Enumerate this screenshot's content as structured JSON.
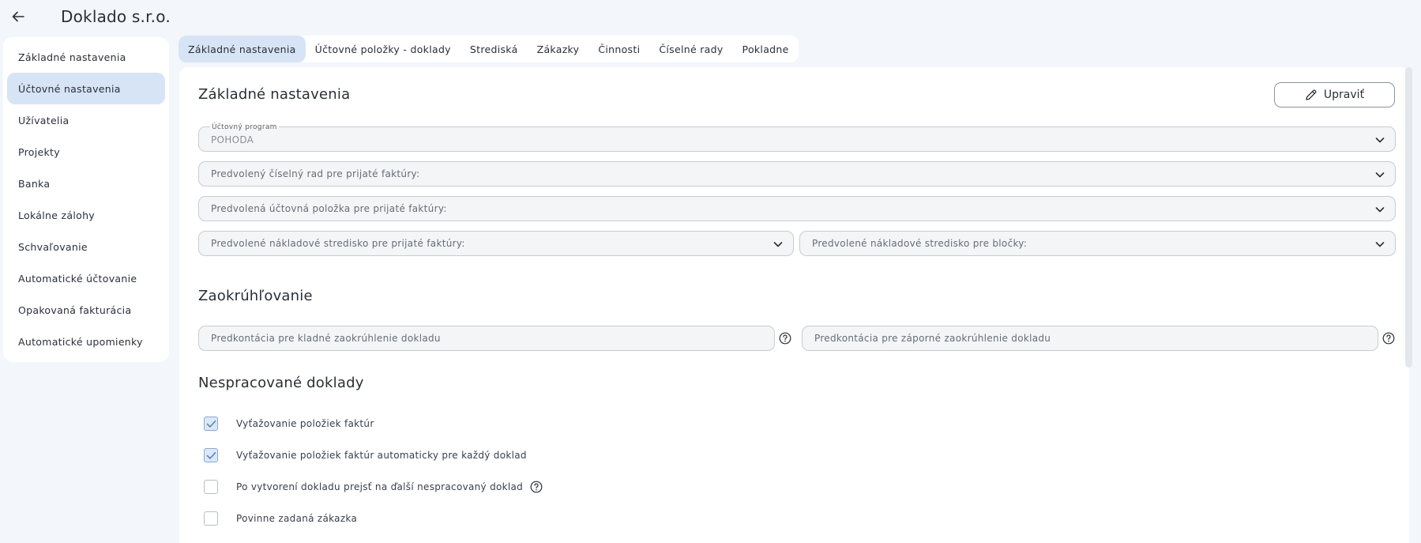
{
  "header": {
    "company_name": "Doklado s.r.o.",
    "back_icon": "arrow-left-icon"
  },
  "sidebar": {
    "items": [
      {
        "label": "Základné nastavenia",
        "active": false
      },
      {
        "label": "Účtovné nastavenia",
        "active": true
      },
      {
        "label": "Užívatelia",
        "active": false
      },
      {
        "label": "Projekty",
        "active": false
      },
      {
        "label": "Banka",
        "active": false
      },
      {
        "label": "Lokálne zálohy",
        "active": false
      },
      {
        "label": "Schvaľovanie",
        "active": false
      },
      {
        "label": "Automatické účtovanie",
        "active": false
      },
      {
        "label": "Opakovaná fakturácia",
        "active": false
      },
      {
        "label": "Automatické upomienky",
        "active": false
      }
    ]
  },
  "tabs": [
    {
      "label": "Základné nastavenia",
      "active": true
    },
    {
      "label": "Účtovné položky - doklady",
      "active": false
    },
    {
      "label": "Strediská",
      "active": false
    },
    {
      "label": "Zákazky",
      "active": false
    },
    {
      "label": "Činnosti",
      "active": false
    },
    {
      "label": "Číselné rady",
      "active": false
    },
    {
      "label": "Pokladne",
      "active": false
    }
  ],
  "basic": {
    "title": "Základné nastavenia",
    "edit_label": "Upraviť",
    "edit_icon": "pencil-icon",
    "accounting_program": {
      "label": "Účtovný program",
      "value": "POHODA"
    },
    "default_number_series": "Predvolený číselný rad pre prijaté faktúry:",
    "default_accounting_item": "Predvolená účtovná položka pre prijaté faktúry:",
    "default_cost_center_invoices": "Predvolené nákladové stredisko pre prijaté faktúry:",
    "default_cost_center_receipts": "Predvolené nákladové stredisko pre bločky:"
  },
  "rounding": {
    "title": "Zaokrúhľovanie",
    "positive_placeholder": "Predkontácia pre kladné zaokrúhlenie dokladu",
    "negative_placeholder": "Predkontácia pre záporné zaokrúhlenie dokladu"
  },
  "unprocessed": {
    "title": "Nespracované doklady",
    "options": [
      {
        "label": "Vyťažovanie položiek faktúr",
        "checked": true
      },
      {
        "label": "Vyťažovanie položiek faktúr automaticky pre každý doklad",
        "checked": true
      },
      {
        "label": "Po vytvorení dokladu prejsť na ďalší nespracovaný doklad",
        "checked": false
      },
      {
        "label": "Povinne zadaná zákazka",
        "checked": false
      }
    ]
  },
  "colors": {
    "accent": "#d6e4f6",
    "background": "#f3f6fa",
    "surface": "#ffffff"
  }
}
